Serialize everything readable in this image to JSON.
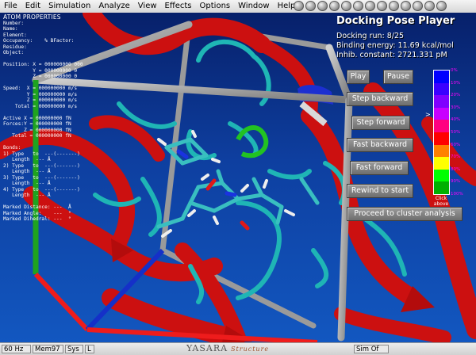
{
  "menu": {
    "items": [
      "File",
      "Edit",
      "Simulation",
      "Analyze",
      "View",
      "Effects",
      "Options",
      "Window",
      "Help"
    ],
    "toolbar_count": 13
  },
  "atom_properties": {
    "title": "ATOM PROPERTIES",
    "lines": [
      "Number:",
      "Name:",
      "Element:",
      "Occupancy:    % BFactor:",
      "Residue:",
      "Object:",
      "",
      "Position: X = 000000000 000",
      "          Y = 000000000 0",
      "          Z = 000000000 0",
      "",
      "Speed:  X = 000000000 m/s",
      "        Y = 000000000 m/s",
      "        Z = 000000000 m/s",
      "    Total = 000000000 m/s",
      "",
      "Active X = 000000000 fN",
      "Forces:Y = 000000000 fN",
      "       Z = 000000000 fN",
      "   Total = 000000000 fN",
      "",
      "Bonds:",
      "1) Type   to  ---(-------)",
      "   Length  --- Å",
      "2) Type   to  ---(-------)",
      "   Length  --- Å",
      "3) Type   to  ---(-------)",
      "   Length  --- Å",
      "4) Type   to  ---(-------)",
      "   Length  --- Å",
      "",
      "Marked Distance: ---  Å",
      "Marked Angle:    ---  °",
      "Marked Dihedral: ---  °"
    ]
  },
  "docking": {
    "title": "Docking Pose Player",
    "run_line": "Docking run:       8/25",
    "energy_line": "Binding energy: 11.69 kcal/mol",
    "inhib_line": "Inhib. constant: 2721.331 pM",
    "buttons": {
      "play": "Play",
      "pause": "Pause",
      "step_backward": "Step backward",
      "step_forward": "Step forward",
      "fast_backward": "Fast backward",
      "fast_forward": "Fast forward",
      "rewind": "Rewind to start",
      "cluster": "Proceed to cluster analysis"
    }
  },
  "scale": {
    "labels": [
      "0%",
      "10%",
      "20%",
      "30%",
      "40%",
      "50%",
      "60%",
      "70%",
      "80%",
      "90%",
      "100%"
    ],
    "colors": [
      "#0000ff",
      "#3a00ff",
      "#8000ff",
      "#c800ff",
      "#ff0080",
      "#ff0000",
      "#ff8000",
      "#ffff00",
      "#00ff00",
      "#00b000"
    ],
    "click_above": "Click above",
    "arrow": ">"
  },
  "status": {
    "fps": "60 Hz",
    "mem": "Mem97",
    "sys": "Sys",
    "l": "L",
    "logo": "YASARA",
    "logo_sub": "Structure",
    "sim": "Sim Of"
  },
  "colors": {
    "background_top": "#07206a",
    "background_bottom": "#1257c0",
    "ribbon": "#d21414",
    "carbon": "#22b8b8",
    "box": "#a8a8a8"
  }
}
